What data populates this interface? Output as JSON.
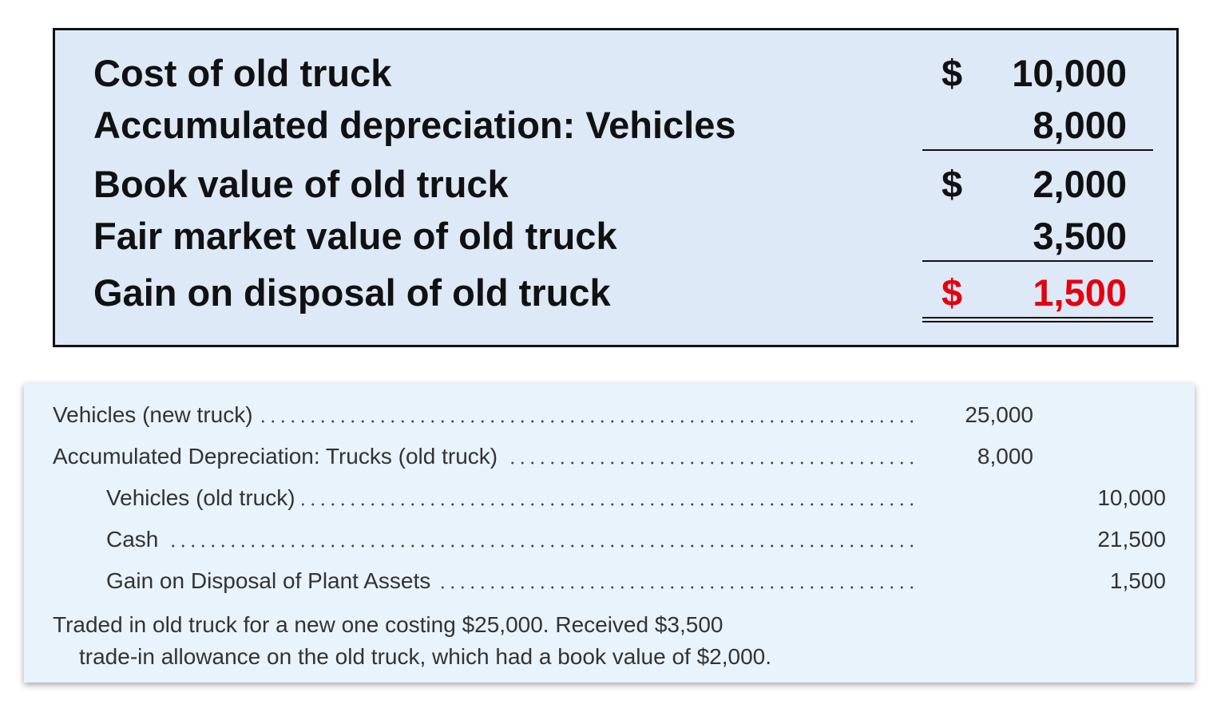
{
  "calculation": {
    "rows": [
      {
        "label": "Cost of old truck",
        "currency": "$",
        "amount": "10,000"
      },
      {
        "label": "Accumulated depreciation: Vehicles",
        "currency": "",
        "amount": "8,000"
      },
      {
        "label": "Book value of old truck",
        "currency": "$",
        "amount": "2,000"
      },
      {
        "label": "Fair market value of old truck",
        "currency": "",
        "amount": "3,500"
      },
      {
        "label": "Gain on disposal of old truck",
        "currency": "$",
        "amount": "1,500"
      }
    ],
    "colors": {
      "text": "#111111",
      "result": "#e5000f",
      "background": "#dde9f6"
    }
  },
  "journal_entry": {
    "lines": [
      {
        "account": "Vehicles (new truck)",
        "debit": "25,000",
        "credit": ""
      },
      {
        "account": "Accumulated Depreciation: Trucks (old truck)",
        "debit": "8,000",
        "credit": ""
      },
      {
        "account": "Vehicles (old truck)",
        "debit": "",
        "credit": "10,000"
      },
      {
        "account": "Cash",
        "debit": "",
        "credit": "21,500"
      },
      {
        "account": "Gain on Disposal of Plant Assets",
        "debit": "",
        "credit": "1,500"
      }
    ],
    "note_line1": "Traded in old truck for a new one costing $25,000. Received $3,500",
    "note_line2": "trade-in allowance on the old truck, which had a book value of $2,000.",
    "colors": {
      "text": "#333333",
      "background": "#e8f3fc"
    }
  }
}
